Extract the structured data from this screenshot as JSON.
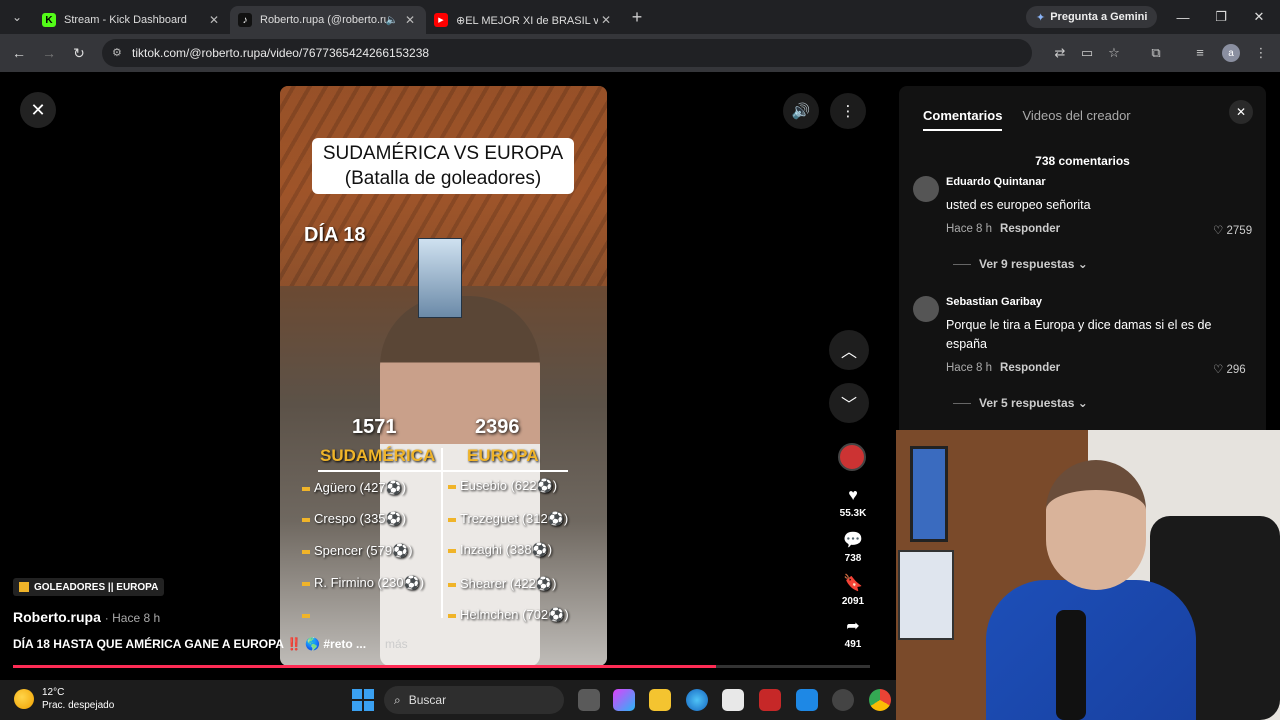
{
  "browser": {
    "tabs": [
      {
        "title": "Stream - Kick Dashboard",
        "favicon": "K",
        "color": "#53fc18"
      },
      {
        "title": "Roberto.rupa (@roberto.rupa)",
        "favicon": "♪",
        "color": "#111111"
      },
      {
        "title": "⊕EL MEJOR XI de BRASIL vs EL",
        "favicon": "▶",
        "color": "#ff0000"
      }
    ],
    "new_tab_label": "+",
    "gemini_label": "Pregunta a Gemini",
    "url": "tiktok.com/@roberto.rupa/video/7677365424266153238",
    "profile_initial": "a"
  },
  "video": {
    "overlay_title_1": "SUDAMÉRICA VS EUROPA",
    "overlay_title_2": "(Batalla de goleadores)",
    "day_label": "DÍA 18",
    "score_left": "1571",
    "score_right": "2396",
    "team_left": "SUDAMÉRICA",
    "team_right": "EUROPA",
    "players_left": [
      "Agüero (427⚽)",
      "Crespo (335⚽)",
      "Spencer (579⚽)",
      "R. Firmino (230⚽)",
      ""
    ],
    "players_right": [
      "Eusebio (622⚽)",
      "Trezeguet (312⚽)",
      "Inzaghi (338⚽)",
      "Shearer (422⚽)",
      "Helmchen (702⚽)"
    ],
    "playlist_badge": "GOLEADORES || EUROPA",
    "author": "Roberto.rupa",
    "posted": "· Hace 8 h",
    "caption": "DÍA 18 HASTA QUE AMÉRICA GANE A EUROPA ‼️ 🌎 #reto ...",
    "more_label": "más",
    "progress": 0.82,
    "likes": "55.3K",
    "comments": "738",
    "saves": "2091",
    "shares": "491"
  },
  "comments_panel": {
    "tab_comments": "Comentarios",
    "tab_creator": "Videos del creador",
    "count_label": "738 comentarios",
    "comments": [
      {
        "name": "Eduardo Quintanar",
        "text": "usted es europeo señorita",
        "time": "Hace 8 h",
        "reply": "Responder",
        "likes": "2759",
        "replies": "Ver 9 respuestas ⌄"
      },
      {
        "name": "Sebastian Garibay",
        "text": "Porque le tira a Europa y dice damas si el es de españa",
        "time": "Hace 8 h",
        "reply": "Responder",
        "likes": "296",
        "replies": "Ver 5 respuestas ⌄"
      }
    ]
  },
  "taskbar": {
    "temperature": "12°C",
    "weather": "Prac. despejado",
    "search_placeholder": "Buscar"
  }
}
